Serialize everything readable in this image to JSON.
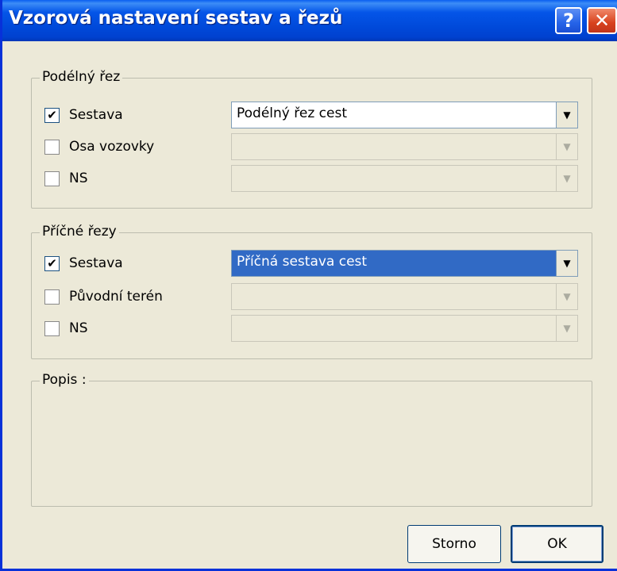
{
  "window": {
    "title": "Vzorová nastavení sestav a řezů",
    "help_label": "?",
    "close_label": "✕"
  },
  "longitudinal": {
    "legend": "Podélný řez",
    "rows": [
      {
        "label": "Sestava",
        "checked": true,
        "value": "Podélný řez cest",
        "enabled": true,
        "selected": false
      },
      {
        "label": "Osa vozovky",
        "checked": false,
        "value": "",
        "enabled": false,
        "selected": false
      },
      {
        "label": "NS",
        "checked": false,
        "value": "",
        "enabled": false,
        "selected": false
      }
    ]
  },
  "cross": {
    "legend": "Příčné řezy",
    "rows": [
      {
        "label": "Sestava",
        "checked": true,
        "value": "Příčná sestava cest",
        "enabled": true,
        "selected": true
      },
      {
        "label": "Původní terén",
        "checked": false,
        "value": "",
        "enabled": false,
        "selected": false
      },
      {
        "label": "NS",
        "checked": false,
        "value": "",
        "enabled": false,
        "selected": false
      }
    ]
  },
  "description": {
    "legend": "Popis :"
  },
  "buttons": {
    "cancel": "Storno",
    "ok": "OK"
  },
  "icons": {
    "checkbox_checked": "✔",
    "dropdown_arrow": "▼"
  }
}
